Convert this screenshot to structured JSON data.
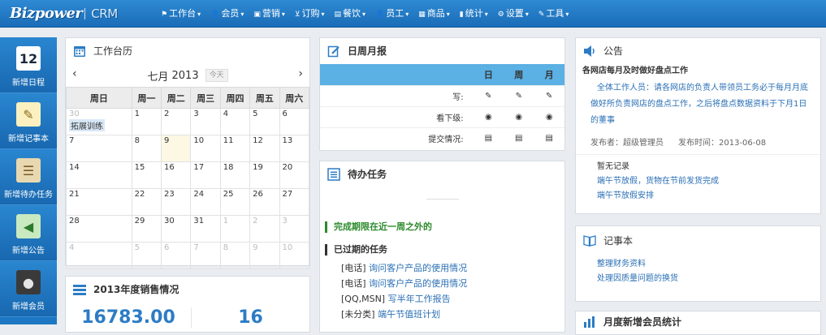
{
  "app": {
    "logo_main": "Bizpower",
    "logo_sub": "CRM"
  },
  "nav": [
    {
      "label": "工作台",
      "icon": "flag-icon",
      "glyph": "⚑"
    },
    {
      "label": "会员",
      "icon": "user-icon",
      "glyph": "👤"
    },
    {
      "label": "营销",
      "icon": "briefcase-icon",
      "glyph": "▣"
    },
    {
      "label": "订购",
      "icon": "cart-icon",
      "glyph": "⊻"
    },
    {
      "label": "餐饮",
      "icon": "table-icon",
      "glyph": "▤"
    },
    {
      "label": "员工",
      "icon": "staff-icon",
      "glyph": "👤"
    },
    {
      "label": "商品",
      "icon": "product-icon",
      "glyph": "▦"
    },
    {
      "label": "统计",
      "icon": "stats-icon",
      "glyph": "▮"
    },
    {
      "label": "设置",
      "icon": "gear-icon",
      "glyph": "⚙"
    },
    {
      "label": "工具",
      "icon": "wrench-icon",
      "glyph": "✎"
    }
  ],
  "sidebar": [
    {
      "label": "新增日程",
      "icon": "calendar-icon",
      "glyph": "12",
      "bg": "#ffffff",
      "fg": "#1a2a3a"
    },
    {
      "label": "新增记事本",
      "icon": "notepad-icon",
      "glyph": "✎",
      "bg": "#fbf0c0",
      "fg": "#8a6d1e"
    },
    {
      "label": "新增待办任务",
      "icon": "clipboard-icon",
      "glyph": "☰",
      "bg": "#e8d8b0",
      "fg": "#7a5a2a"
    },
    {
      "label": "新增公告",
      "icon": "megaphone-icon",
      "glyph": "◀",
      "bg": "#c9e9c0",
      "fg": "#2b7a2b"
    },
    {
      "label": "新增会员",
      "icon": "member-icon",
      "glyph": "●",
      "bg": "#3a3a3a",
      "fg": "#e5e5e5"
    }
  ],
  "calendar": {
    "title": "工作台历",
    "month": "七月",
    "year": "2013",
    "today_btn": "今天",
    "prev": "‹",
    "next": "›",
    "weekdays": [
      "周日",
      "周一",
      "周二",
      "周三",
      "周四",
      "周五",
      "周六"
    ],
    "weeks": [
      [
        {
          "d": "30",
          "dim": true
        },
        {
          "d": "1"
        },
        {
          "d": "2"
        },
        {
          "d": "3"
        },
        {
          "d": "4"
        },
        {
          "d": "5"
        },
        {
          "d": "6"
        }
      ],
      [
        {
          "d": "7"
        },
        {
          "d": "8"
        },
        {
          "d": "9",
          "today": true
        },
        {
          "d": "10"
        },
        {
          "d": "11"
        },
        {
          "d": "12"
        },
        {
          "d": "13"
        }
      ],
      [
        {
          "d": "14"
        },
        {
          "d": "15"
        },
        {
          "d": "16"
        },
        {
          "d": "17"
        },
        {
          "d": "18"
        },
        {
          "d": "19"
        },
        {
          "d": "20"
        }
      ],
      [
        {
          "d": "21"
        },
        {
          "d": "22"
        },
        {
          "d": "23"
        },
        {
          "d": "24"
        },
        {
          "d": "25"
        },
        {
          "d": "26"
        },
        {
          "d": "27"
        }
      ],
      [
        {
          "d": "28"
        },
        {
          "d": "29"
        },
        {
          "d": "30"
        },
        {
          "d": "31"
        },
        {
          "d": "1",
          "dim": true
        },
        {
          "d": "2",
          "dim": true
        },
        {
          "d": "3",
          "dim": true
        }
      ],
      [
        {
          "d": "4",
          "dim": true
        },
        {
          "d": "5",
          "dim": true
        },
        {
          "d": "6",
          "dim": true
        },
        {
          "d": "7",
          "dim": true
        },
        {
          "d": "8",
          "dim": true
        },
        {
          "d": "9",
          "dim": true
        },
        {
          "d": "10",
          "dim": true
        }
      ]
    ],
    "event": "拓展训练"
  },
  "sales": {
    "title": "2013年度销售情况",
    "value1": "16783.00",
    "value2": "16"
  },
  "report": {
    "title": "日周月报",
    "cols": [
      "日",
      "周",
      "月"
    ],
    "rows": [
      {
        "label": "写:",
        "icon": "pencil-icon",
        "glyph": "✎"
      },
      {
        "label": "看下级:",
        "icon": "eye-icon",
        "glyph": "◉"
      },
      {
        "label": "提交情况:",
        "icon": "list-icon",
        "glyph": "▤"
      }
    ]
  },
  "todo": {
    "title": "待办任务",
    "sec1": "完成期限在近一周之外的",
    "sec2": "已过期的任务",
    "tasks": [
      {
        "tag": "[电话]",
        "text": "询问客户产品的使用情况"
      },
      {
        "tag": "[电话]",
        "text": "询问客户产品的使用情况"
      },
      {
        "tag": "[QQ,MSN]",
        "text": "写半年工作报告"
      },
      {
        "tag": "[未分类]",
        "text": "端午节值班计划"
      }
    ]
  },
  "notice": {
    "title": "公告",
    "headline": "各网店每月及时做好盘点工作",
    "body": "全体工作人员：请各网店的负责人带领员工务必于每月月底做好所负责网店的盘点工作，之后将盘点数据资料于下月1日的董事",
    "publisher": "发布者：超级管理员",
    "time": "发布时间：2013-06-08",
    "empty": "暂无记录",
    "links": [
      "端午节放假，货物在节前发货完成",
      "端午节放假安排"
    ]
  },
  "notes": {
    "title": "记事本",
    "items": [
      "整理财务资料",
      "处理因质量问题的换货"
    ]
  },
  "member_stats": {
    "title": "月度新增会员统计"
  }
}
